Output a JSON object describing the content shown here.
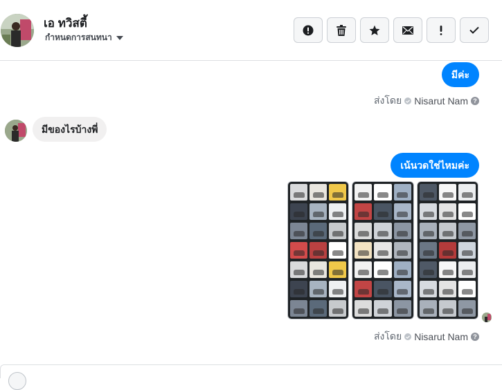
{
  "header": {
    "contact_name": "เอ ทวิสตี้",
    "assign_label": "กำหนดการสนทนา",
    "toolbar": [
      {
        "icon": "alert-circle-icon",
        "name": "spam-button"
      },
      {
        "icon": "trash-icon",
        "name": "delete-button"
      },
      {
        "icon": "star-icon",
        "name": "star-button"
      },
      {
        "icon": "envelope-icon",
        "name": "mark-unread-button"
      },
      {
        "icon": "exclamation-icon",
        "name": "follow-up-button"
      },
      {
        "icon": "checkmark-icon",
        "name": "mark-done-button"
      }
    ]
  },
  "messages": {
    "out_1": "มีค่ะ",
    "sent_by_1": {
      "prefix": "ส่งโดย",
      "agent": "Nisarut Nam",
      "help": "?"
    },
    "in_1": "มีของไรบ้างพี่",
    "out_2": "เน้นวดใช่ไหมค่ะ",
    "sent_by_2": {
      "prefix": "ส่งโดย",
      "agent": "Nisarut Nam",
      "help": "?"
    }
  },
  "attachments": [
    {
      "name": "screenshot-1"
    },
    {
      "name": "screenshot-2"
    },
    {
      "name": "screenshot-3"
    }
  ],
  "colors": {
    "accent": "#0084ff",
    "incoming_bubble": "#f1f0f0",
    "thumb_background": "#1f2326"
  }
}
